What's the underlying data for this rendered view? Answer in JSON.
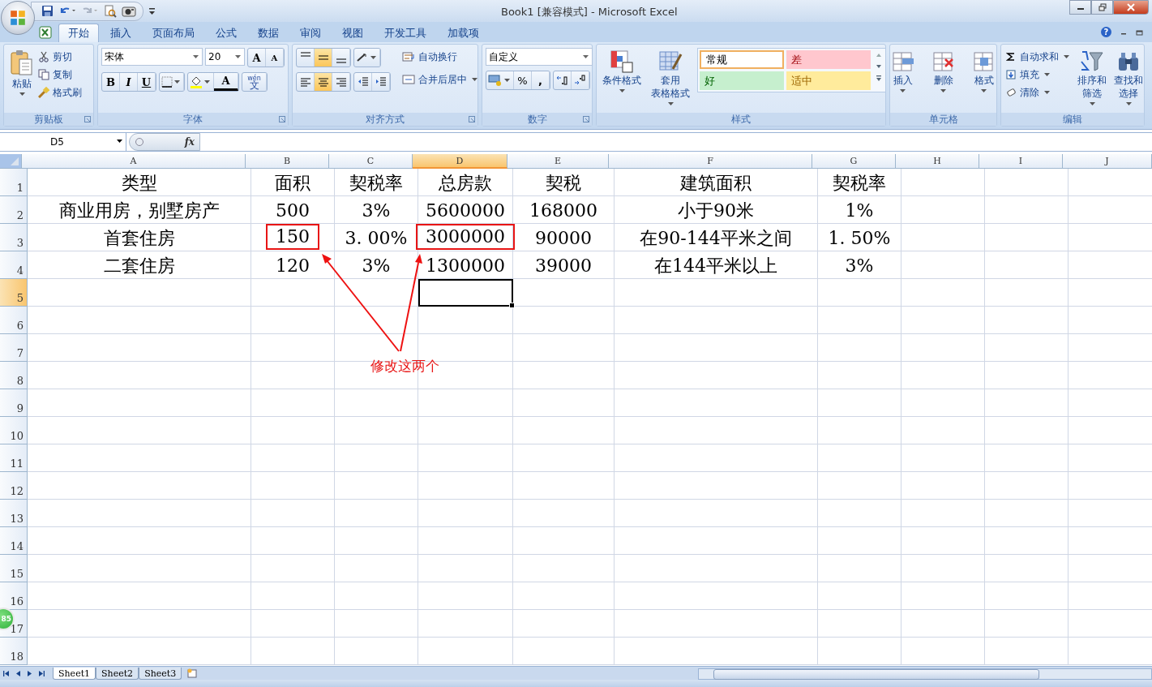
{
  "title": "Book1  [兼容模式] - Microsoft Excel",
  "tabs": [
    {
      "label": "开始",
      "selected": true
    },
    {
      "label": "插入",
      "selected": false
    },
    {
      "label": "页面布局",
      "selected": false
    },
    {
      "label": "公式",
      "selected": false
    },
    {
      "label": "数据",
      "selected": false
    },
    {
      "label": "审阅",
      "selected": false
    },
    {
      "label": "视图",
      "selected": false
    },
    {
      "label": "开发工具",
      "selected": false
    },
    {
      "label": "加载项",
      "selected": false
    }
  ],
  "help": "?",
  "ribbon": {
    "clipboard": {
      "paste": "粘贴",
      "items": [
        "剪切",
        "复制",
        "格式刷"
      ],
      "label": "剪贴板"
    },
    "font": {
      "name": "宋体",
      "size": "20",
      "grow": "A",
      "shrink": "A",
      "styles": [
        {
          "label": "B",
          "kind": "bold"
        },
        {
          "label": "I",
          "kind": "italic"
        },
        {
          "label": "U",
          "kind": "underline"
        }
      ],
      "color_button": "A",
      "phonetic_top": "wén",
      "phonetic": "文",
      "label": "字体"
    },
    "alignment": {
      "wrap": "自动换行",
      "merge": "合并后居中",
      "label": "对齐方式"
    },
    "number": {
      "format": "自定义",
      "percent": "%",
      "comma": ",",
      "label": "数字"
    },
    "styles": {
      "conditional": "条件格式",
      "table": [
        "套用",
        "表格格式"
      ],
      "gallery": [
        {
          "label": "常规",
          "kind": "normal"
        },
        {
          "label": "差",
          "kind": "bad"
        },
        {
          "label": "好",
          "kind": "good"
        },
        {
          "label": "适中",
          "kind": "neutral"
        }
      ],
      "label": "样式"
    },
    "cells": {
      "buttons": [
        "插入",
        "删除",
        "格式"
      ],
      "label": "单元格"
    },
    "editing": {
      "items": [
        "自动求和",
        "填充",
        "清除"
      ],
      "sort": [
        "排序和",
        "筛选"
      ],
      "find": [
        "查找和",
        "选择"
      ],
      "label": "编辑"
    }
  },
  "name_box": "D5",
  "fx": "fx",
  "columns": [
    {
      "label": "A",
      "selected": false
    },
    {
      "label": "B",
      "selected": false
    },
    {
      "label": "C",
      "selected": false
    },
    {
      "label": "D",
      "selected": true
    },
    {
      "label": "E",
      "selected": false
    },
    {
      "label": "F",
      "selected": false
    },
    {
      "label": "G",
      "selected": false
    },
    {
      "label": "H",
      "selected": false
    },
    {
      "label": "I",
      "selected": false
    },
    {
      "label": "J",
      "selected": false
    }
  ],
  "rows": [
    {
      "label": "1",
      "selected": false,
      "cells": [
        {
          "text": "类型",
          "highlighted": false
        },
        {
          "text": "面积",
          "highlighted": false
        },
        {
          "text": "契税率",
          "highlighted": false
        },
        {
          "text": "总房款",
          "highlighted": false
        },
        {
          "text": "契税",
          "highlighted": false
        },
        {
          "text": "建筑面积",
          "highlighted": false
        },
        {
          "text": "契税率",
          "highlighted": false
        }
      ]
    },
    {
      "label": "2",
      "selected": false,
      "cells": [
        {
          "text": "商业用房，别墅房产",
          "highlighted": false
        },
        {
          "text": "500",
          "highlighted": false
        },
        {
          "text": "3%",
          "highlighted": false
        },
        {
          "text": "5600000",
          "highlighted": false
        },
        {
          "text": "168000",
          "highlighted": false
        },
        {
          "text": "小于90米",
          "highlighted": false
        },
        {
          "text": "1%",
          "highlighted": false
        }
      ]
    },
    {
      "label": "3",
      "selected": false,
      "cells": [
        {
          "text": "首套住房",
          "highlighted": false
        },
        {
          "text": "150",
          "highlighted": true
        },
        {
          "text": "3. 00%",
          "highlighted": false
        },
        {
          "text": "3000000",
          "highlighted": true
        },
        {
          "text": "90000",
          "highlighted": false
        },
        {
          "text": "在90-144平米之间",
          "highlighted": false
        },
        {
          "text": "1. 50%",
          "highlighted": false
        }
      ]
    },
    {
      "label": "4",
      "selected": false,
      "cells": [
        {
          "text": "二套住房",
          "highlighted": false
        },
        {
          "text": "120",
          "highlighted": false
        },
        {
          "text": "3%",
          "highlighted": false
        },
        {
          "text": "1300000",
          "highlighted": false
        },
        {
          "text": "39000",
          "highlighted": false
        },
        {
          "text": "在144平米以上",
          "highlighted": false
        },
        {
          "text": "3%",
          "highlighted": false
        }
      ]
    },
    {
      "label": "5",
      "selected": true
    },
    {
      "label": "6",
      "selected": false
    },
    {
      "label": "7",
      "selected": false
    },
    {
      "label": "8",
      "selected": false
    },
    {
      "label": "9",
      "selected": false
    },
    {
      "label": "10",
      "selected": false
    },
    {
      "label": "11",
      "selected": false
    },
    {
      "label": "12",
      "selected": false
    },
    {
      "label": "13",
      "selected": false
    },
    {
      "label": "14",
      "selected": false
    },
    {
      "label": "15",
      "selected": false
    },
    {
      "label": "16",
      "selected": false
    },
    {
      "label": "17",
      "selected": false
    },
    {
      "label": "18",
      "selected": false
    }
  ],
  "annotation": {
    "text": "修改这两个"
  },
  "badge": "85",
  "sheets": [
    {
      "label": "Sheet1",
      "selected": true
    },
    {
      "label": "Sheet2",
      "selected": false
    },
    {
      "label": "Sheet3",
      "selected": false
    }
  ]
}
